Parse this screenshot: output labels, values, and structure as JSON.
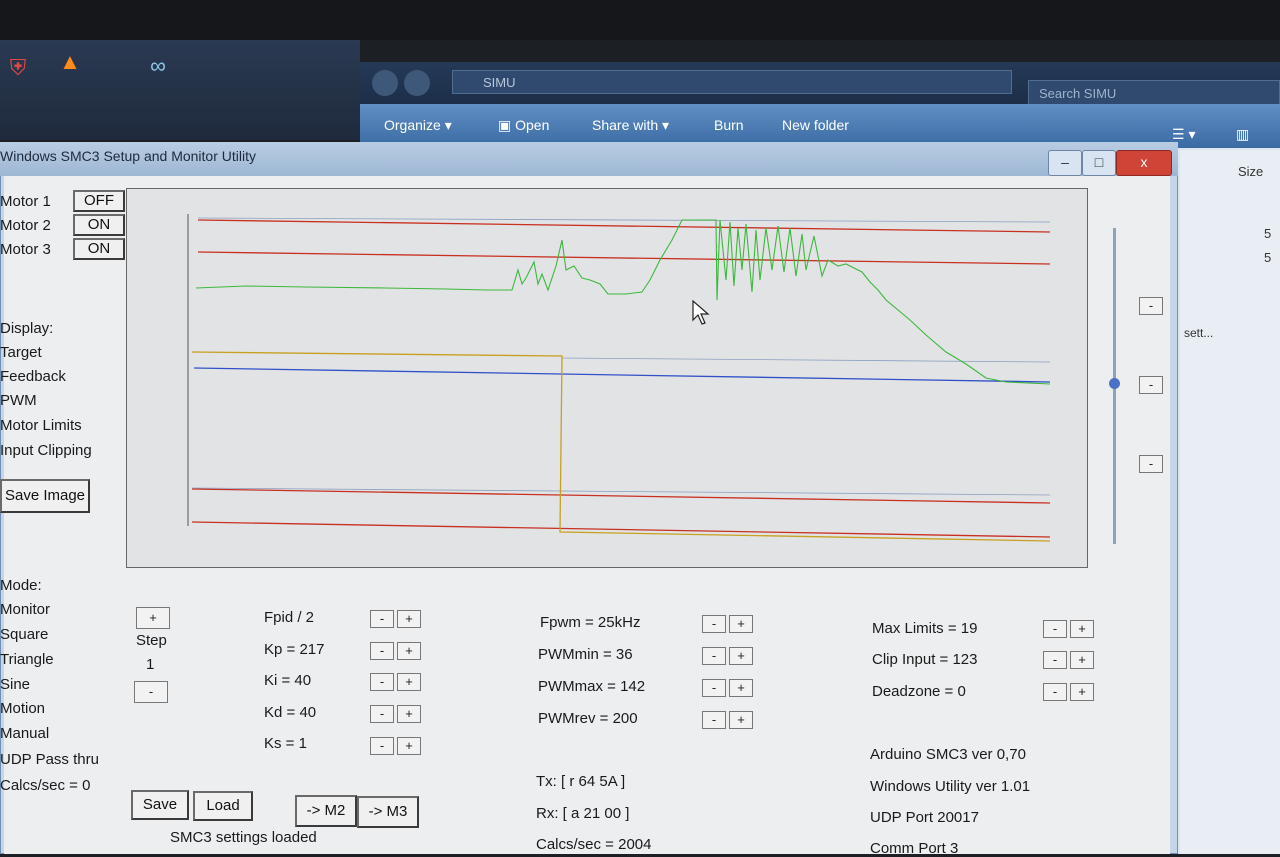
{
  "taskbar": {
    "icons": [
      "shield-icon",
      "vlc-cone-icon",
      "arduino-icon"
    ]
  },
  "explorer": {
    "address": "SIMU",
    "search_placeholder": "Search SIMU",
    "toolbar": {
      "organize": "Organize",
      "open": "Open",
      "share_with": "Share with",
      "burn": "Burn",
      "new_folder": "New folder"
    },
    "size_header": "Size",
    "sizes": [
      "5",
      "5"
    ],
    "side_text": "sett..."
  },
  "window": {
    "title": "Windows SMC3 Setup and Monitor Utility",
    "controls": {
      "minimize": "–",
      "maximize": "□",
      "close": "x"
    }
  },
  "motors": [
    {
      "label": "Motor 1",
      "state": "OFF"
    },
    {
      "label": "Motor 2",
      "state": "ON"
    },
    {
      "label": "Motor 3",
      "state": "ON"
    }
  ],
  "display": {
    "heading": "Display:",
    "items": [
      "Target",
      "Feedback",
      "PWM",
      "Motor Limits",
      "Input Clipping"
    ],
    "save_image": "Save Image"
  },
  "mode": {
    "heading": "Mode:",
    "items": [
      "Monitor",
      "Square",
      "Triangle",
      "Sine",
      "Motion",
      "Manual",
      "UDP Pass thru"
    ],
    "calcs": "Calcs/sec = 0",
    "step_label": "Step",
    "step_value": "1",
    "plus": "+",
    "minus": "-"
  },
  "pid": {
    "fpid": "Fpid / 2",
    "kp": "Kp = 217",
    "ki": "Ki = 40",
    "kd": "Kd = 40",
    "ks": "Ks = 1"
  },
  "pwm": {
    "fpwm": "Fpwm = 25kHz",
    "pwmmin": "PWMmin = 36",
    "pwmmax": "PWMmax = 142",
    "pwmrev": "PWMrev = 200"
  },
  "limits": {
    "max_limits": "Max Limits = 19",
    "clip_input": "Clip Input = 123",
    "deadzone": "Deadzone = 0"
  },
  "comm": {
    "tx": "Tx: [ r 64 5A ]",
    "rx": "Rx: [ a 21 00 ]",
    "calcs": "Calcs/sec = 2004"
  },
  "info": {
    "arduino": "Arduino SMC3 ver 0,70",
    "utility": "Windows Utility ver 1.01",
    "udp": "UDP Port 20017",
    "comm_port": "Comm Port 3"
  },
  "footer": {
    "save": "Save",
    "load": "Load",
    "m2": "-> M2",
    "m3": "-> M3",
    "status": "SMC3 settings loaded"
  },
  "zoom_buttons": [
    "-",
    "-",
    "-"
  ],
  "colors": {
    "feedback": "#3cb83c",
    "target": "#c8a020",
    "limits": "#c83020",
    "reference": "#3050c8",
    "window": "#c5d6e8"
  }
}
